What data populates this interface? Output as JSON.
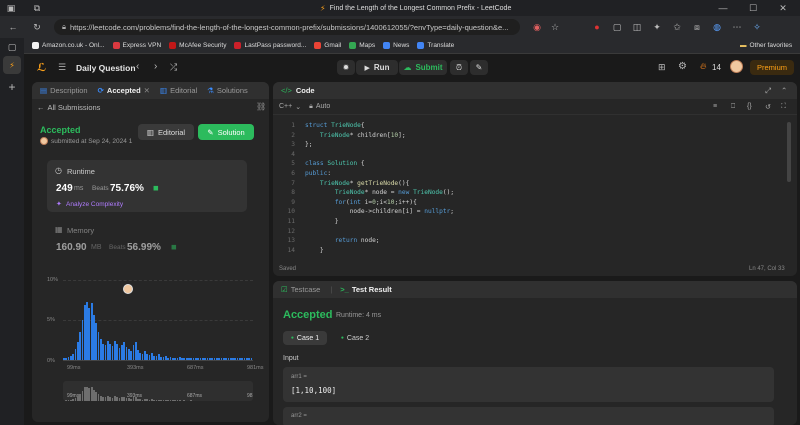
{
  "browser": {
    "tab_title": "Find the Length of the Longest Common Prefix - LeetCode",
    "url": "https://leetcode.com/problems/find-the-length-of-the-longest-common-prefix/submissions/1400612055/?envType=daily-question&e...",
    "bookmarks": [
      {
        "label": "Amazon.co.uk - Onl...",
        "color": "#f3f3f3"
      },
      {
        "label": "Express VPN",
        "color": "#da3940"
      },
      {
        "label": "McAfee Security",
        "color": "#c01818"
      },
      {
        "label": "LastPass password...",
        "color": "#cc2029"
      },
      {
        "label": "Gmail",
        "color": "#ea4335"
      },
      {
        "label": "Maps",
        "color": "#34a853"
      },
      {
        "label": "News",
        "color": "#4285f4"
      },
      {
        "label": "Translate",
        "color": "#4285f4"
      }
    ],
    "other_favorites": "Other favorites"
  },
  "nav": {
    "problem_list": "Daily Question",
    "run": "Run",
    "submit": "Submit",
    "streak": "14",
    "premium": "Premium"
  },
  "left": {
    "tabs": [
      "Description",
      "Accepted",
      "Editorial",
      "Solutions"
    ],
    "all_submissions": "All Submissions",
    "status": "Accepted",
    "submitted_at": "submitted at Sep 24, 2024 1",
    "editorial_btn": "Editorial",
    "solution_btn": "Solution",
    "runtime": {
      "label": "Runtime",
      "value": "249",
      "unit": "ms",
      "beats_label": "Beats",
      "beats": "75.76%",
      "analyze": "Analyze Complexity"
    },
    "memory": {
      "label": "Memory",
      "value": "160.90",
      "unit": "MB",
      "beats_label": "Beats",
      "beats": "56.99%"
    }
  },
  "chart_data": {
    "type": "bar",
    "y_ticks": [
      "10%",
      "5%",
      "0%"
    ],
    "x_ticks": [
      "99ms",
      "393ms",
      "687ms",
      "981ms"
    ],
    "ylim": [
      0,
      10
    ],
    "values": [
      0.2,
      0.3,
      0.4,
      0.5,
      0.8,
      1.4,
      2.2,
      3.4,
      5.0,
      6.8,
      7.2,
      6.4,
      7.0,
      5.6,
      4.6,
      3.4,
      2.6,
      2.0,
      1.8,
      2.4,
      2.0,
      1.7,
      2.4,
      2.0,
      1.5,
      1.8,
      2.2,
      1.6,
      1.3,
      1.1,
      1.8,
      2.2,
      1.2,
      0.9,
      0.7,
      1.1,
      0.8,
      0.6,
      0.9,
      0.5,
      0.5,
      0.7,
      0.4,
      0.4,
      0.5,
      0.3,
      0.4,
      0.3,
      0.3,
      0.3,
      0.4,
      0.2,
      0.3,
      0.2,
      0.2,
      0.3,
      0.2,
      0.2,
      0.2,
      0.2,
      0.2,
      0.2,
      0.2,
      0.2,
      0.2,
      0.2,
      0.2,
      0.2,
      0.2,
      0.2,
      0.2,
      0.2,
      0.2,
      0.2,
      0.2,
      0.2,
      0.2,
      0.2,
      0.2,
      0.2,
      0.2,
      0.2
    ]
  },
  "code": {
    "title": "Code",
    "language": "C++",
    "mode": "Auto",
    "saved": "Saved",
    "cursor": "Ln 47, Col 33"
  },
  "result": {
    "tabs": [
      "Testcase",
      "Test Result"
    ],
    "status": "Accepted",
    "runtime": "Runtime: 4 ms",
    "cases": [
      "Case 1",
      "Case 2"
    ],
    "input_label": "Input",
    "var1_name": "arr1 =",
    "var1_value": "[1,10,100]",
    "var2_name": "arr2 ="
  }
}
